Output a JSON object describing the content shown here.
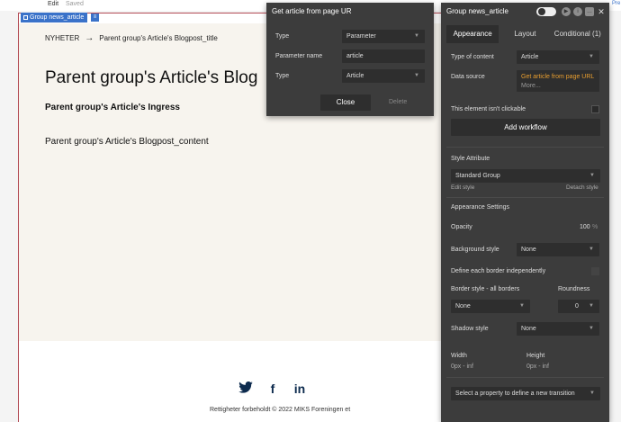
{
  "topbar": {
    "edit": "Edit",
    "saved": "Saved",
    "pre": "Pre"
  },
  "selection": {
    "label": "Group news_article"
  },
  "page": {
    "breadcrumb": {
      "section": "NYHETER",
      "arrow": "→",
      "current": "Parent group's Article's Blogpost_title"
    },
    "title": "Parent group's Article's Blog",
    "ingress": "Parent group's Article's Ingress",
    "content": "Parent group's Article's Blogpost_content",
    "social": {
      "twitter": "🐦",
      "facebook": "f",
      "linkedin": "in"
    },
    "copyright": "Rettigheter forbeholdt © 2022 MIKS Foreningen et"
  },
  "url_dialog": {
    "title": "Get article from page UR",
    "type_label": "Type",
    "type_value": "Parameter",
    "param_label": "Parameter name",
    "param_value": "article",
    "type2_label": "Type",
    "type2_value": "Article",
    "close": "Close",
    "delete": "Delete"
  },
  "inspector": {
    "title": "Group news_article",
    "tabs": [
      "Appearance",
      "Layout",
      "Conditional (1)"
    ],
    "type_of_content_label": "Type of content",
    "type_of_content_value": "Article",
    "data_source_label": "Data source",
    "data_source_value": "Get article from page URL",
    "data_source_more": "More...",
    "not_clickable_label": "This element isn't clickable",
    "add_workflow": "Add workflow",
    "style_attribute_label": "Style Attribute",
    "style_value": "Standard Group",
    "edit_style": "Edit style",
    "detach_style": "Detach style",
    "appearance_settings": "Appearance Settings",
    "opacity_label": "Opacity",
    "opacity_value": "100",
    "opacity_unit": "%",
    "background_label": "Background style",
    "background_value": "None",
    "border_independent_label": "Define each border independently",
    "border_style_label": "Border style - all borders",
    "roundness_label": "Roundness",
    "border_style_value": "None",
    "roundness_value": "0",
    "shadow_label": "Shadow style",
    "shadow_value": "None",
    "width_label": "Width",
    "width_value": "0px - inf",
    "height_label": "Height",
    "height_value": "0px - inf",
    "transition_placeholder": "Select a property to define a new transition"
  }
}
